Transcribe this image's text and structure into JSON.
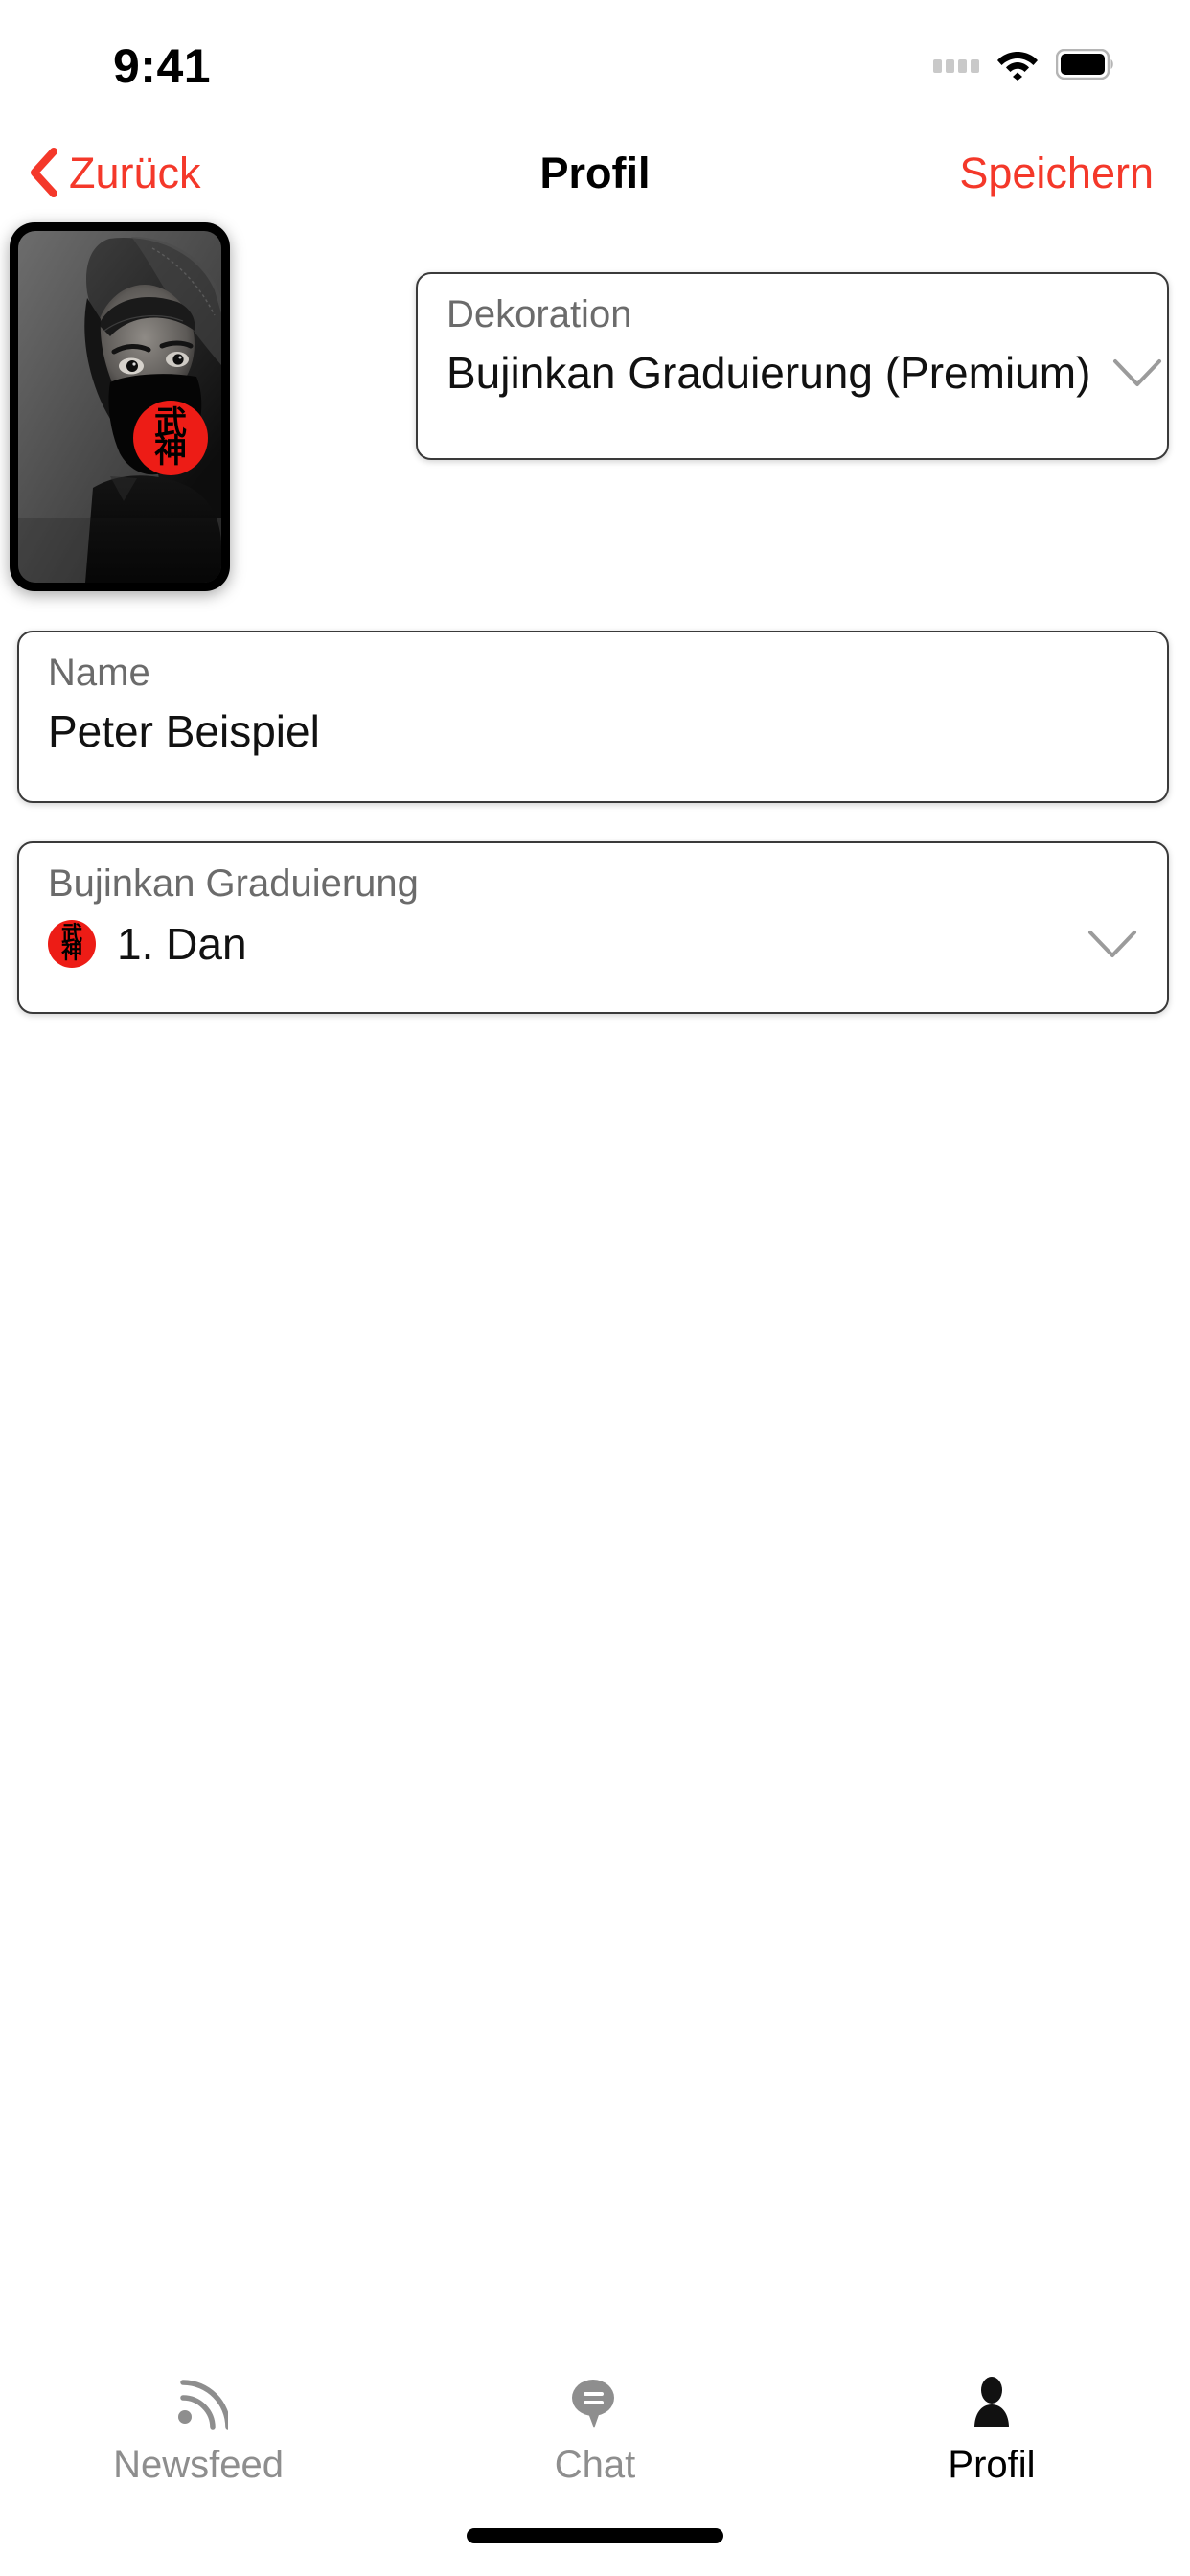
{
  "status_bar": {
    "time": "9:41",
    "icons": [
      "signal-dots-icon",
      "wifi-icon",
      "battery-icon"
    ]
  },
  "nav_bar": {
    "back_label": "Zurück",
    "back_icon": "chevron-left-icon",
    "title": "Profil",
    "action_label": "Speichern",
    "accent_color": "#F4382A"
  },
  "avatar": {
    "alt": "profile-photo-hooded-person-grayscale",
    "badge_text_top": "武",
    "badge_text_bottom": "神",
    "badge_color": "#ED1C16"
  },
  "fields": {
    "dekoration": {
      "label": "Dekoration",
      "value": "Bujinkan Graduierung (Premium)",
      "chevron": "chevron-down-icon"
    },
    "name": {
      "label": "Name",
      "value": "Peter Beispiel",
      "placeholder": "Name"
    },
    "graduierung": {
      "label": "Bujinkan Graduierung",
      "value": "1. Dan",
      "badge_text_top": "武",
      "badge_text_bottom": "神",
      "chevron": "chevron-down-icon"
    }
  },
  "tab_bar": {
    "items": [
      {
        "label": "Newsfeed",
        "icon": "rss-icon",
        "active": false
      },
      {
        "label": "Chat",
        "icon": "speech-bubble-icon",
        "active": false
      },
      {
        "label": "Profil",
        "icon": "person-icon",
        "active": true
      }
    ]
  }
}
